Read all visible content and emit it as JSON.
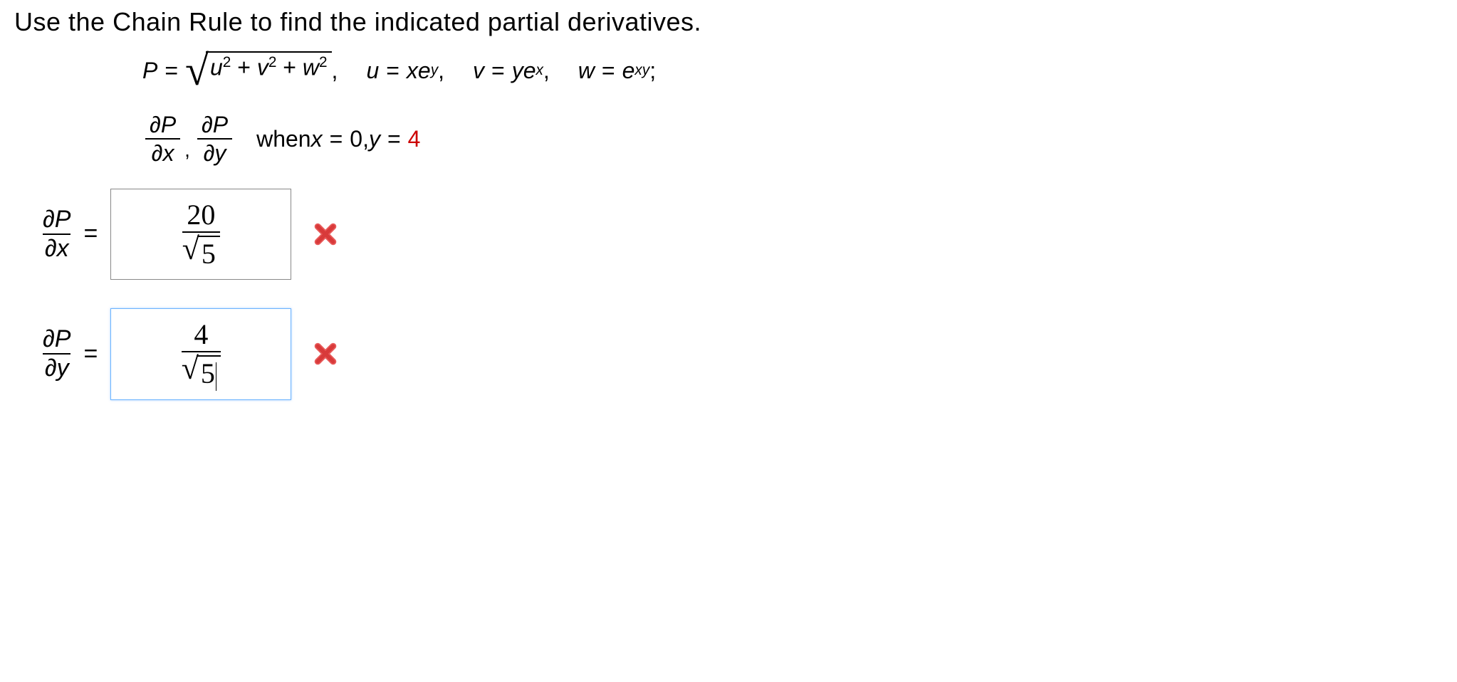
{
  "instruction": "Use the Chain Rule to find the indicated partial derivatives.",
  "definitions": {
    "P_lhs": "P",
    "equals": "=",
    "radicand_u": "u",
    "radicand_v": "v",
    "radicand_w": "w",
    "sq": "2",
    "plus": " + ",
    "u_def_lhs": "u",
    "u_def_rhs_base": "xe",
    "u_def_rhs_exp": "y",
    "v_def_lhs": "v",
    "v_def_rhs_base": "ye",
    "v_def_rhs_exp": "x",
    "w_def_lhs": "w",
    "w_def_rhs_base": "e",
    "w_def_rhs_exp": "xy",
    "semicolon": ";",
    "comma": ","
  },
  "sought": {
    "dP": "∂P",
    "dx": "∂x",
    "dy": "∂y",
    "when_text": "when ",
    "x_label": "x",
    "x_value": "0",
    "y_label": "y",
    "y_value": "4",
    "comma_sep": ", "
  },
  "answers": {
    "row1": {
      "lhs_num": "∂P",
      "lhs_den": "∂x",
      "value_num": "20",
      "value_den_inside": "5",
      "status": "incorrect"
    },
    "row2": {
      "lhs_num": "∂P",
      "lhs_den": "∂y",
      "value_num": "4",
      "value_den_inside": "5",
      "status": "incorrect"
    }
  }
}
